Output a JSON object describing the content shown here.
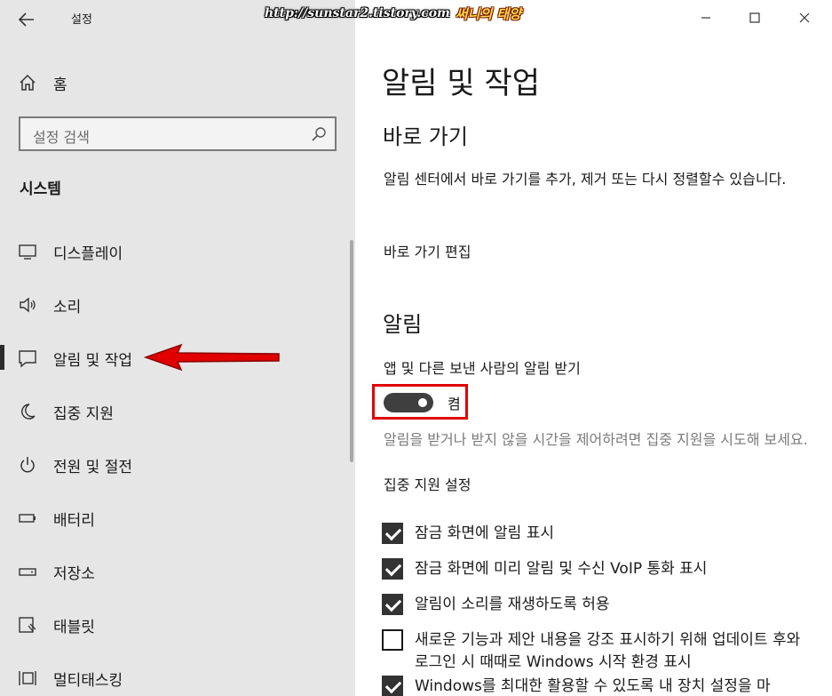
{
  "window": {
    "title": "설정"
  },
  "banner": {
    "url": "http://sunstar2.tistory.com",
    "tag": "써니의 태양"
  },
  "sidebar": {
    "home_label": "홈",
    "search_placeholder": "설정 검색",
    "section_title": "시스템",
    "items": [
      {
        "label": "디스플레이",
        "icon": "monitor-icon"
      },
      {
        "label": "소리",
        "icon": "speaker-icon"
      },
      {
        "label": "알림 및 작업",
        "icon": "notification-icon",
        "selected": true
      },
      {
        "label": "집중 지원",
        "icon": "moon-icon"
      },
      {
        "label": "전원 및 절전",
        "icon": "power-icon"
      },
      {
        "label": "배터리",
        "icon": "battery-icon"
      },
      {
        "label": "저장소",
        "icon": "storage-icon"
      },
      {
        "label": "태블릿",
        "icon": "tablet-icon"
      },
      {
        "label": "멀티태스킹",
        "icon": "multitasking-icon"
      }
    ]
  },
  "main": {
    "title": "알림 및 작업",
    "quick_actions": {
      "heading": "바로 가기",
      "description": "알림 센터에서 바로 가기를 추가, 제거 또는 다시 정렬할수 있습니다.",
      "edit_link": "바로 가기 편집"
    },
    "notifications": {
      "heading": "알림",
      "get_notifications_label": "앱 및 다른 보낸 사람의 알림 받기",
      "toggle_state": "켬",
      "toggle_on": true,
      "focus_hint": "알림을 받거나 받지 않을 시간을 제어하려면 집중 지원을 시도해 보세요.",
      "focus_link": "집중 지원 설정",
      "checkboxes": [
        {
          "label": "잠금 화면에 알림 표시",
          "checked": true
        },
        {
          "label": "잠금 화면에 미리 알림 및 수신 VoIP 통화 표시",
          "checked": true
        },
        {
          "label": "알림이 소리를 재생하도록 허용",
          "checked": true
        },
        {
          "label": "새로운 기능과 제안 내용을 강조 표시하기 위해 업데이트 후와 로그인 시 때때로 Windows 시작 환경 표시",
          "checked": false
        },
        {
          "label": "Windows를 최대한 활용할 수 있도록 내 장치 설정을 마",
          "checked": true
        }
      ]
    }
  },
  "colors": {
    "accent_red": "#e00000",
    "sidebar_bg": "#e6e6e6",
    "toggle_on": "#3f3f3f"
  }
}
